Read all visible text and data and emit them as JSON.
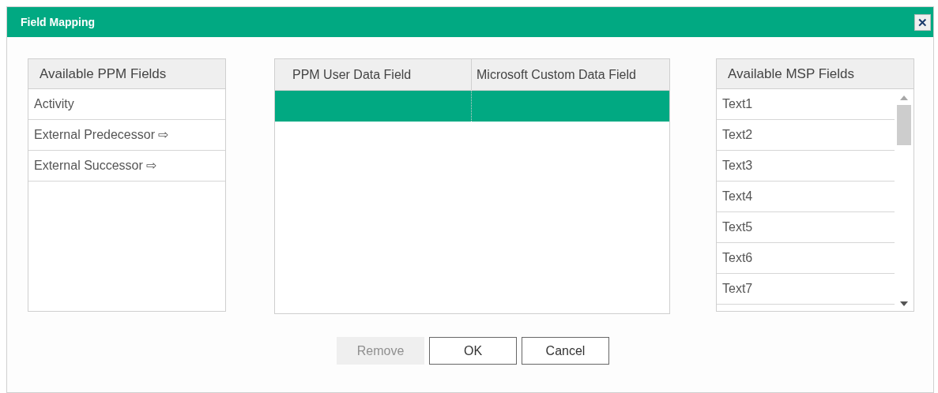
{
  "window": {
    "title": "Field Mapping",
    "close_glyph": "✕"
  },
  "ppm_fields": {
    "header": "Available PPM Fields",
    "items": [
      "Activity",
      "External Predecessor ⇨",
      "External Successor ⇨"
    ]
  },
  "mapping_table": {
    "columns": [
      "PPM User Data Field",
      "Microsoft Custom Data Field"
    ],
    "rows": [
      {
        "selected": true
      }
    ]
  },
  "msp_fields": {
    "header": "Available MSP Fields",
    "items": [
      "Text1",
      "Text2",
      "Text3",
      "Text4",
      "Text5",
      "Text6",
      "Text7"
    ]
  },
  "buttons": [
    {
      "label": "Remove",
      "disabled": true
    },
    {
      "label": "OK",
      "disabled": false
    },
    {
      "label": "Cancel",
      "disabled": false
    }
  ]
}
